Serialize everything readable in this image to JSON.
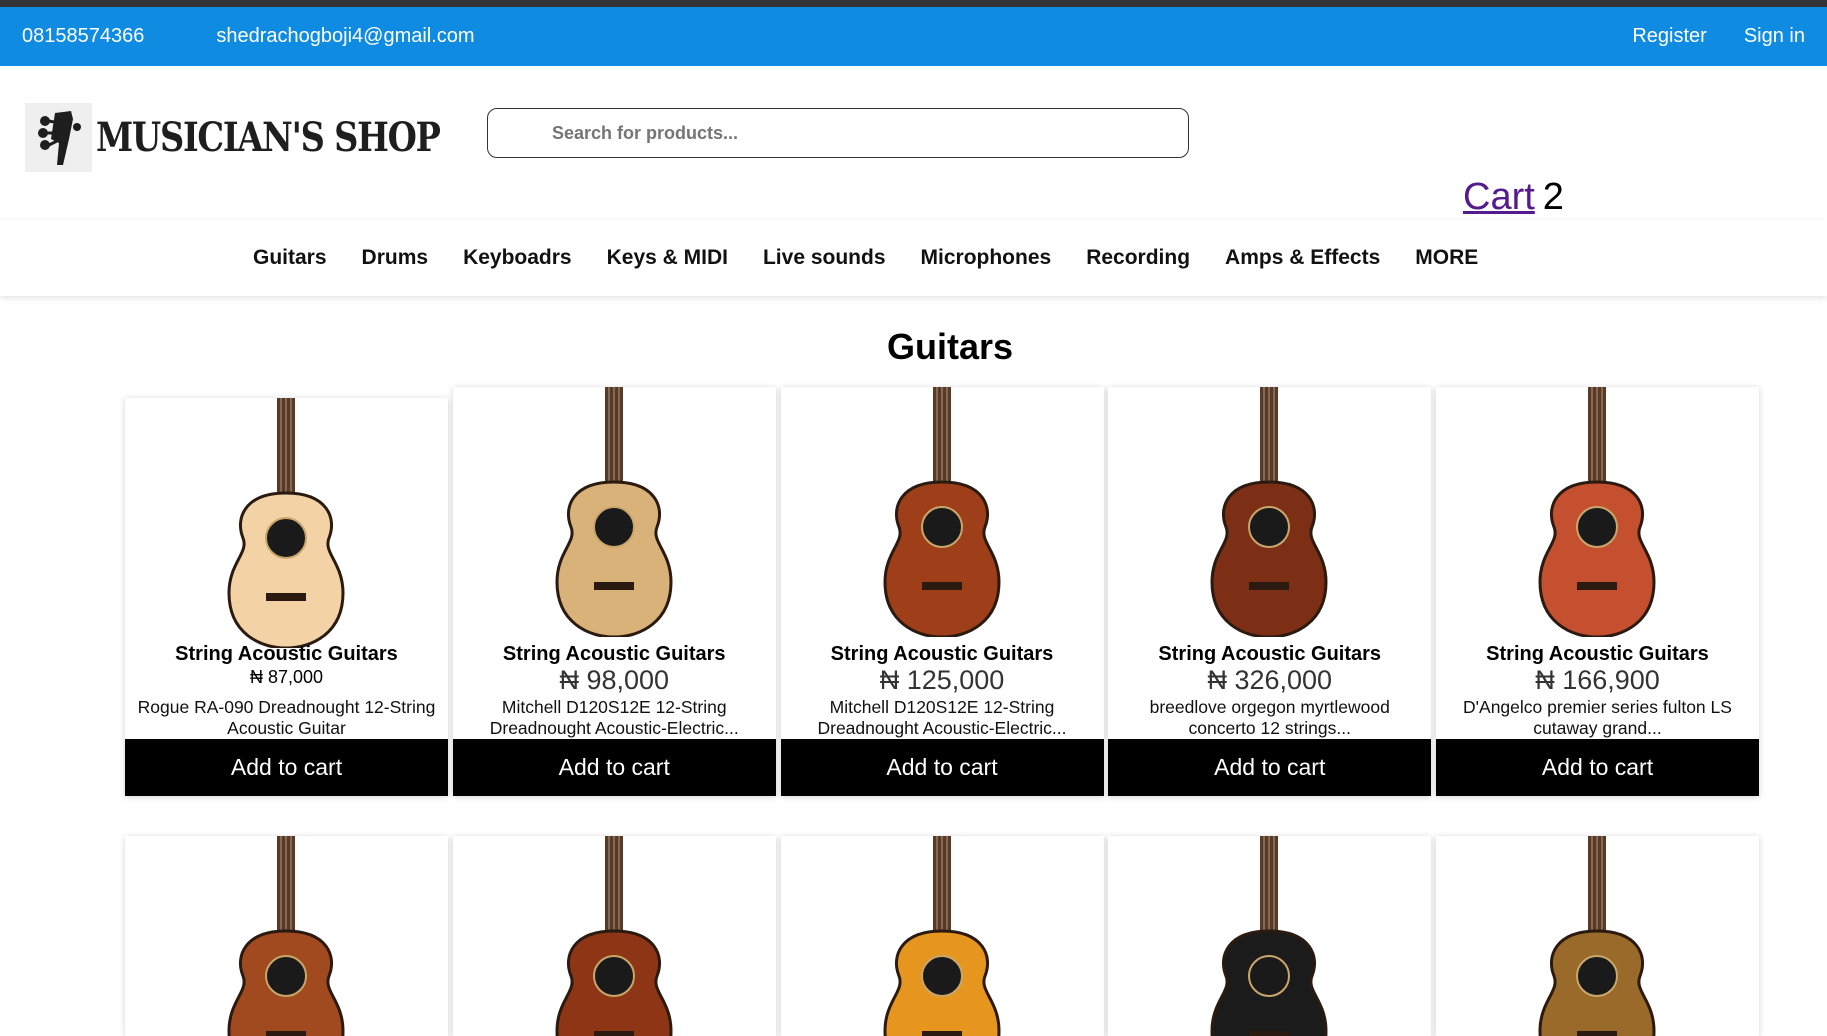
{
  "topbar": {
    "phone": "08158574366",
    "email": "shedrachogboji4@gmail.com",
    "register": "Register",
    "signin": "Sign in"
  },
  "header": {
    "logo_text": "MUSICIAN'S SHOP",
    "search_placeholder": "Search for products...",
    "cart_label": "Cart",
    "cart_count": "2"
  },
  "nav": {
    "items": [
      "Guitars",
      "Drums",
      "Keyboadrs",
      "Keys & MIDI",
      "Live sounds",
      "Microphones",
      "Recording",
      "Amps & Effects",
      "MORE"
    ]
  },
  "section": {
    "title": "Guitars"
  },
  "products": [
    {
      "category": "String Acoustic Guitars",
      "price": "₦ 87,000",
      "description": "Rogue RA-090 Dreadnought 12-String Acoustic Guitar",
      "button": "Add to cart",
      "body_color": "#f3d3a6",
      "image_icon": "acoustic-guitar-natural"
    },
    {
      "category": "String Acoustic Guitars",
      "price": "₦ 98,000",
      "description": "Mitchell D120S12E 12-String Dreadnought Acoustic-Electric...",
      "button": "Add to cart",
      "body_color": "#d9b27a",
      "image_icon": "acoustic-guitar-natural"
    },
    {
      "category": "String Acoustic Guitars",
      "price": "₦ 125,000",
      "description": "Mitchell D120S12E 12-String Dreadnought Acoustic-Electric...",
      "button": "Add to cart",
      "body_color": "#9e3f19",
      "image_icon": "acoustic-guitar-sunburst"
    },
    {
      "category": "String Acoustic Guitars",
      "price": "₦ 326,000",
      "description": "breedlove orgegon myrtlewood concerto 12 strings...",
      "button": "Add to cart",
      "body_color": "#7d2f15",
      "image_icon": "acoustic-guitar-sunburst"
    },
    {
      "category": "String Acoustic Guitars",
      "price": "₦ 166,900",
      "description": "D'Angelco premier series fulton LS cutaway grand...",
      "button": "Add to cart",
      "body_color": "#c4502f",
      "image_icon": "acoustic-guitar-mahogany"
    }
  ],
  "products_row2": [
    {
      "body_color": "#a24a1f",
      "image_icon": "acoustic-guitar-sunburst"
    },
    {
      "body_color": "#8e3516",
      "image_icon": "acoustic-guitar-sunburst"
    },
    {
      "body_color": "#e6951f",
      "image_icon": "acoustic-guitar-orange"
    },
    {
      "body_color": "#1b1b1b",
      "image_icon": "acoustic-guitar-black"
    },
    {
      "body_color": "#9a6a2b",
      "image_icon": "acoustic-guitar-burl"
    }
  ]
}
